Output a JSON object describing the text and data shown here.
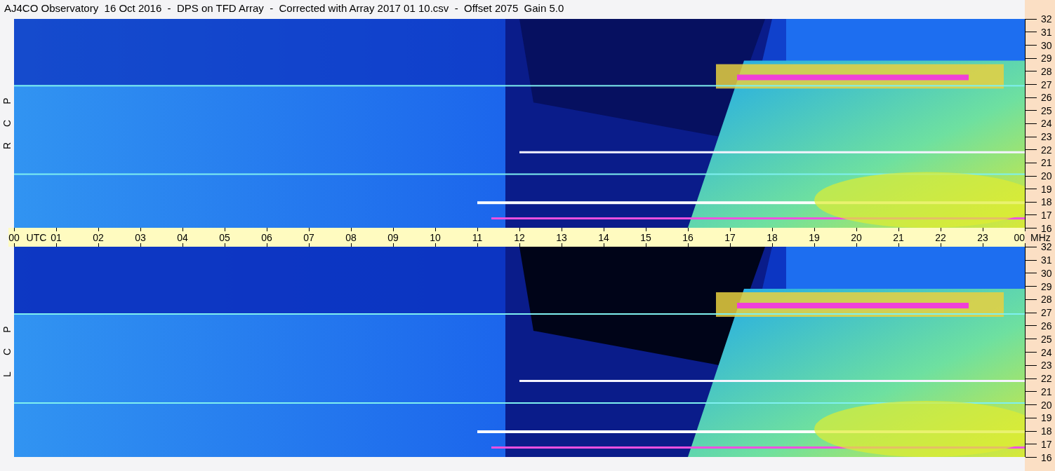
{
  "title": "AJ4CO Observatory  16 Oct 2016  -  DPS on TFD Array  -  Corrected with Array 2017 01 10.csv  -  Offset 2075  Gain 5.0",
  "panels": [
    {
      "polarization": [
        "R",
        "C",
        "P"
      ],
      "frequency_ticks": [
        "32",
        "31",
        "30",
        "29",
        "28",
        "27",
        "26",
        "25",
        "24",
        "23",
        "22",
        "21",
        "20",
        "19",
        "18",
        "17",
        "16"
      ]
    },
    {
      "polarization": [
        "L",
        "C",
        "P"
      ],
      "frequency_ticks": [
        "32",
        "31",
        "30",
        "29",
        "28",
        "27",
        "26",
        "25",
        "24",
        "23",
        "22",
        "21",
        "20",
        "19",
        "18",
        "17",
        "16"
      ]
    }
  ],
  "time_axis": {
    "ticks": [
      "00",
      "01",
      "02",
      "03",
      "04",
      "05",
      "06",
      "07",
      "08",
      "09",
      "10",
      "11",
      "12",
      "13",
      "14",
      "15",
      "16",
      "17",
      "18",
      "19",
      "20",
      "21",
      "22",
      "23",
      "00"
    ],
    "zone": "UTC",
    "unit": "MHz"
  }
}
